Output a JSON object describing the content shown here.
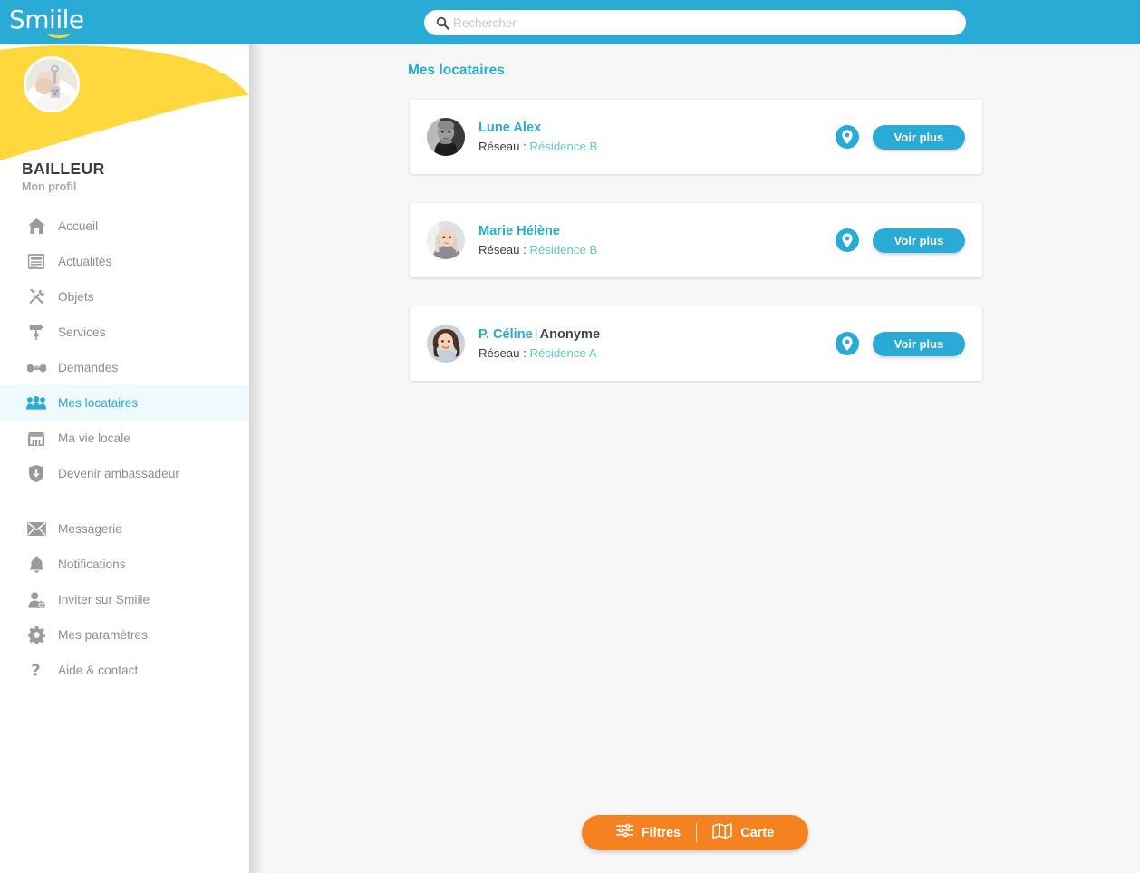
{
  "brand": {
    "logo_text": "Smiile",
    "accent_cyan": "#29abd5",
    "accent_yellow": "#ffd33a",
    "accent_orange": "#f58220",
    "network_green": "#62c9bd"
  },
  "search": {
    "placeholder": "Rechercher",
    "value": "",
    "icon": "search-icon"
  },
  "profile": {
    "name": "BAILLEUR",
    "subtitle": "Mon profil",
    "avatar_icon": "landlord-keys-photo"
  },
  "sidebar": {
    "group_primary": [
      {
        "label": "Accueil",
        "icon": "home-icon",
        "active": false
      },
      {
        "label": "Actualités",
        "icon": "newspaper-icon",
        "active": false
      },
      {
        "label": "Objets",
        "icon": "tools-icon",
        "active": false
      },
      {
        "label": "Services",
        "icon": "paint-roller-icon",
        "active": false
      },
      {
        "label": "Demandes",
        "icon": "handshake-icon",
        "active": false
      },
      {
        "label": "Mes locataires",
        "icon": "users-group-icon",
        "active": true
      },
      {
        "label": "Ma vie locale",
        "icon": "store-icon",
        "active": false
      },
      {
        "label": "Devenir ambassadeur",
        "icon": "shield-icon",
        "active": false
      }
    ],
    "group_secondary": [
      {
        "label": "Messagerie",
        "icon": "envelope-icon",
        "active": false
      },
      {
        "label": "Notifications",
        "icon": "bell-icon",
        "active": false
      },
      {
        "label": "Inviter sur Smiile",
        "icon": "user-plus-icon",
        "active": false
      },
      {
        "label": "Mes paramètres",
        "icon": "gear-icon",
        "active": false
      },
      {
        "label": "Aide & contact",
        "icon": "question-mark-icon",
        "active": false
      }
    ]
  },
  "main": {
    "title": "Mes locataires",
    "network_prefix": "Réseau :",
    "view_more_label": "Voir plus",
    "pin_icon": "map-pin-icon",
    "tenants": [
      {
        "name": "Lune Alex",
        "anonymous_label": "",
        "separator": "",
        "network": "Résidence B",
        "avatar_icon": "tenant-photo-man-grayscale"
      },
      {
        "name": "Marie Hélène",
        "anonymous_label": "",
        "separator": "",
        "network": "Résidence B",
        "avatar_icon": "tenant-photo-blonde-woman"
      },
      {
        "name": "P. Céline",
        "anonymous_label": "Anonyme",
        "separator": "|",
        "network": "Résidence A",
        "avatar_icon": "tenant-photo-brunette-woman"
      }
    ]
  },
  "action_bar": {
    "filters_label": "Filtres",
    "filters_icon": "sliders-icon",
    "map_label": "Carte",
    "map_icon": "map-icon"
  }
}
